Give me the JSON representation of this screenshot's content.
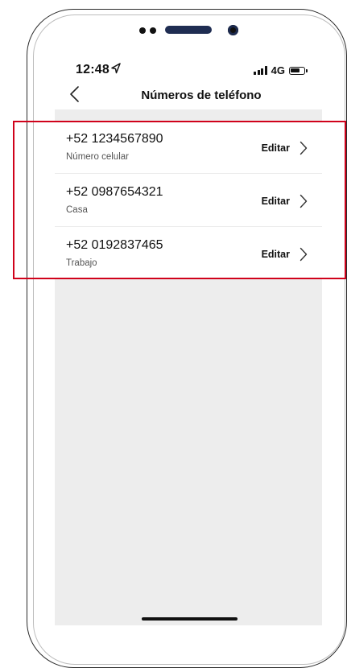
{
  "status_bar": {
    "time": "12:48",
    "network": "4G",
    "location_icon": "location-arrow-icon"
  },
  "nav": {
    "back_icon": "chevron-left-icon",
    "title": "Números de teléfono"
  },
  "phones": [
    {
      "number": "+52 1234567890",
      "label": "Número celular",
      "action": "Editar"
    },
    {
      "number": "+52 0987654321",
      "label": "Casa",
      "action": "Editar"
    },
    {
      "number": "+52 0192837465",
      "label": "Trabajo",
      "action": "Editar"
    }
  ],
  "colors": {
    "highlight": "#d0021b",
    "background": "#ededed"
  }
}
